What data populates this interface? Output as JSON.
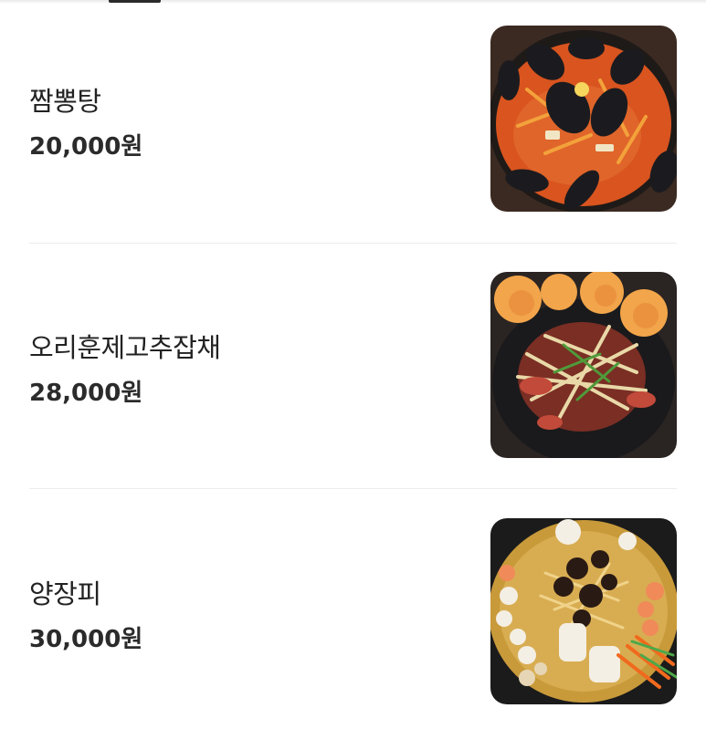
{
  "menu": {
    "items": [
      {
        "name": "짬뽕탕",
        "price": "20,000원",
        "image_icon": "jjamppong-stew-image"
      },
      {
        "name": "오리훈제고추잡채",
        "price": "28,000원",
        "image_icon": "smoked-duck-japchae-image"
      },
      {
        "name": "양장피",
        "price": "30,000원",
        "image_icon": "yangjangpi-image"
      }
    ]
  },
  "colors": {
    "text_primary": "#222222",
    "divider": "#ececec",
    "indicator": "#2a2a2a"
  }
}
